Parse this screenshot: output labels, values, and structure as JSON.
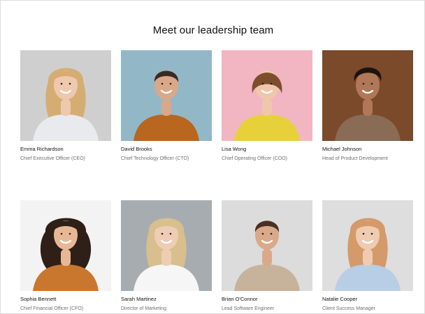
{
  "page": {
    "title": "Meet our leadership team"
  },
  "team": [
    {
      "name": "Emma Richardson",
      "role": "Chief Executive Officer (CEO)",
      "bg": "#cfcfcf",
      "shirt": "#e9eaee",
      "hair": "#d5ad72",
      "skin": "#eec9ae",
      "hair_style": "long-wavy"
    },
    {
      "name": "David Brooks",
      "role": "Chief Technology Officer (CTO)",
      "bg": "#92b8c8",
      "shirt": "#b9661f",
      "hair": "#3a2a20",
      "skin": "#d9a888",
      "hair_style": "short"
    },
    {
      "name": "Lisa Wong",
      "role": "Chief Operating Officer (COO)",
      "bg": "#f2b6c2",
      "shirt": "#e6d13a",
      "hair": "#7d4e2e",
      "skin": "#efc7ab",
      "hair_style": "bob"
    },
    {
      "name": "Michael Johnson",
      "role": "Head of Product Development",
      "bg": "#7a4a2a",
      "shirt": "#8a6b55",
      "hair": "#1c1410",
      "skin": "#b07858",
      "hair_style": "curly-short"
    },
    {
      "name": "Sophia Bennett",
      "role": "Chief Financial Officer (CFO)",
      "bg": "#f3f3f3",
      "shirt": "#c9772e",
      "hair": "#2e1f17",
      "skin": "#e8b896",
      "hair_style": "curly-long"
    },
    {
      "name": "Sarah Martinez",
      "role": "Director of Marketing",
      "bg": "#a7acb1",
      "shirt": "#f6f6f6",
      "hair": "#d8bf8d",
      "skin": "#efcdb4",
      "hair_style": "long-straight"
    },
    {
      "name": "Brian O'Connor",
      "role": "Lead Software Engineer",
      "bg": "#dcdcdc",
      "shirt": "#c7b39c",
      "hair": "#4a3020",
      "skin": "#d9a98a",
      "hair_style": "short"
    },
    {
      "name": "Natalie Cooper",
      "role": "Client Success Manager",
      "bg": "#dedede",
      "shirt": "#b8cde6",
      "hair": "#d49a6a",
      "skin": "#efcbb2",
      "hair_style": "long-straight"
    }
  ]
}
